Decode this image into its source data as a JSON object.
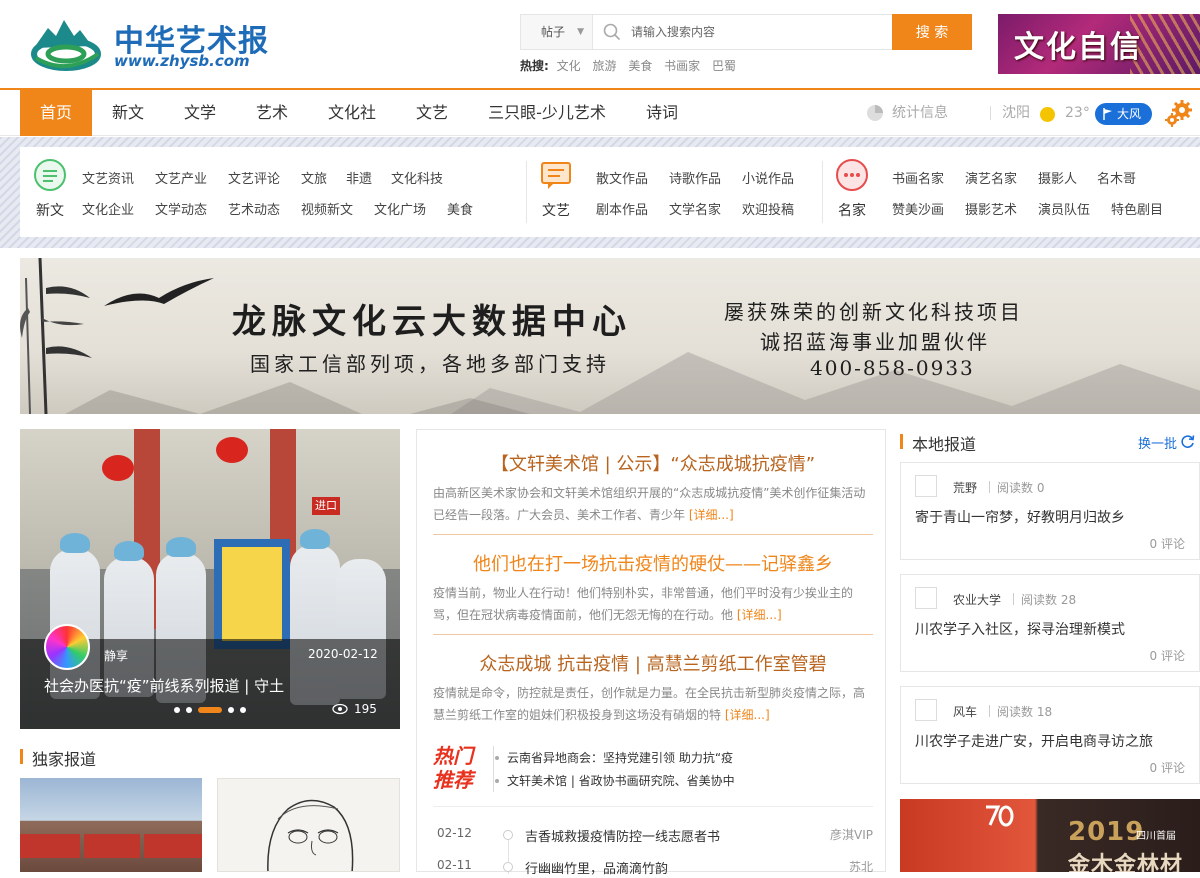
{
  "header": {
    "logo_title": "中华艺术报",
    "logo_url": "www.zhysb.com",
    "search": {
      "type_label": "帖子",
      "placeholder": "请输入搜索内容",
      "button_label": "搜 索"
    },
    "hot_label": "热搜:",
    "hot_items": [
      "文化",
      "旅游",
      "美食",
      "书画家",
      "巴蜀"
    ],
    "ad_text": "文化自信"
  },
  "nav": {
    "items": [
      "首页",
      "新文",
      "文学",
      "艺术",
      "文化社",
      "文艺",
      "三只眼-少儿艺术",
      "诗词"
    ],
    "stats_label": "统计信息",
    "city": "沈阳",
    "temperature": "23°",
    "wind": "大风"
  },
  "categories": {
    "groups": [
      {
        "label": "新文",
        "links": [
          "文艺资讯",
          "文艺产业",
          "文艺评论",
          "文旅",
          "非遗",
          "文化科技",
          "文化企业",
          "文学动态",
          "艺术动态",
          "视频新文",
          "文化广场",
          "美食"
        ]
      },
      {
        "label": "文艺",
        "links": [
          "散文作品",
          "诗歌作品",
          "小说作品",
          "剧本作品",
          "文学名家",
          "欢迎投稿"
        ]
      },
      {
        "label": "名家",
        "links": [
          "书画名家",
          "演艺名家",
          "摄影人",
          "名木哥",
          "赞美沙画",
          "摄影艺术",
          "演员队伍",
          "特色剧目"
        ]
      }
    ]
  },
  "banner": {
    "title": "龙脉文化云大数据中心",
    "subtitle": "国家工信部列项，各地多部门支持",
    "right_line1": "屡获殊荣的创新文化科技项目",
    "right_line2": "诚招蓝海事业加盟伙伴",
    "phone": "400-858-0933"
  },
  "slider": {
    "author": "静享",
    "date": "2020-02-12",
    "title": "社会办医抗“疫”前线系列报道 | 守土",
    "views": "195",
    "sign": "进口",
    "dot_count": 5,
    "active_dot": 2
  },
  "exclusive": {
    "heading": "独家报道"
  },
  "middle": {
    "articles": [
      {
        "title": "【文轩美术馆 | 公示】“众志成城抗疫情”",
        "desc": "由高新区美术家协会和文轩美术馆组织开展的“众志成城抗疫情”美术创作征集活动已经告一段落。广大会员、美术工作者、青少年",
        "more": "[详细...]"
      },
      {
        "title": "他们也在打一场抗击疫情的硬仗——记驿鑫乡",
        "desc": "疫情当前，物业人在行动！他们特别朴实，非常普通，他们平时没有少挨业主的骂，但在冠状病毒疫情面前，他们无怨无悔的在行动。他",
        "more": "[详细...]"
      },
      {
        "title": "众志成城 抗击疫情 | 高慧兰剪纸工作室管碧",
        "desc": "疫情就是命令，防控就是责任，创作就是力量。在全民抗击新型肺炎疫情之际，高慧兰剪纸工作室的姐妹们积极投身到这场没有硝烟的特",
        "more": "[详细...]"
      }
    ],
    "hot_badge": "热门推荐",
    "hot_recs": [
      "云南省异地商会：坚持党建引领 助力抗“疫",
      "文轩美术馆 | 省政协书画研究院、省美协中"
    ],
    "list": [
      {
        "date": "02-12",
        "title": "吉香城救援疫情防控一线志愿者书",
        "author": "彦淇VIP"
      },
      {
        "date": "02-11",
        "title": "行幽幽竹里，品滴滴竹韵",
        "author": "苏北"
      }
    ]
  },
  "local": {
    "heading": "本地报道",
    "swap_label": "换一批",
    "reads_label": "阅读数",
    "comments_suffix": "评论",
    "cards": [
      {
        "author": "荒野",
        "reads": "0",
        "title": "寄于青山一帘梦，好教明月归故乡",
        "comments": "0"
      },
      {
        "author": "农业大学",
        "reads": "28",
        "title": "川农学子入社区，探寻治理新模式",
        "comments": "0"
      },
      {
        "author": "风车",
        "reads": "18",
        "title": "川农学子走进广安，开启电商寻访之旅",
        "comments": "0"
      }
    ],
    "ad": {
      "year": "2019",
      "subtitle": "四川首届",
      "name": "金木金林材"
    }
  },
  "colors": {
    "accent": "#f08519",
    "brand_blue": "#1e6bb8",
    "link_blue": "#1b6fd8"
  }
}
